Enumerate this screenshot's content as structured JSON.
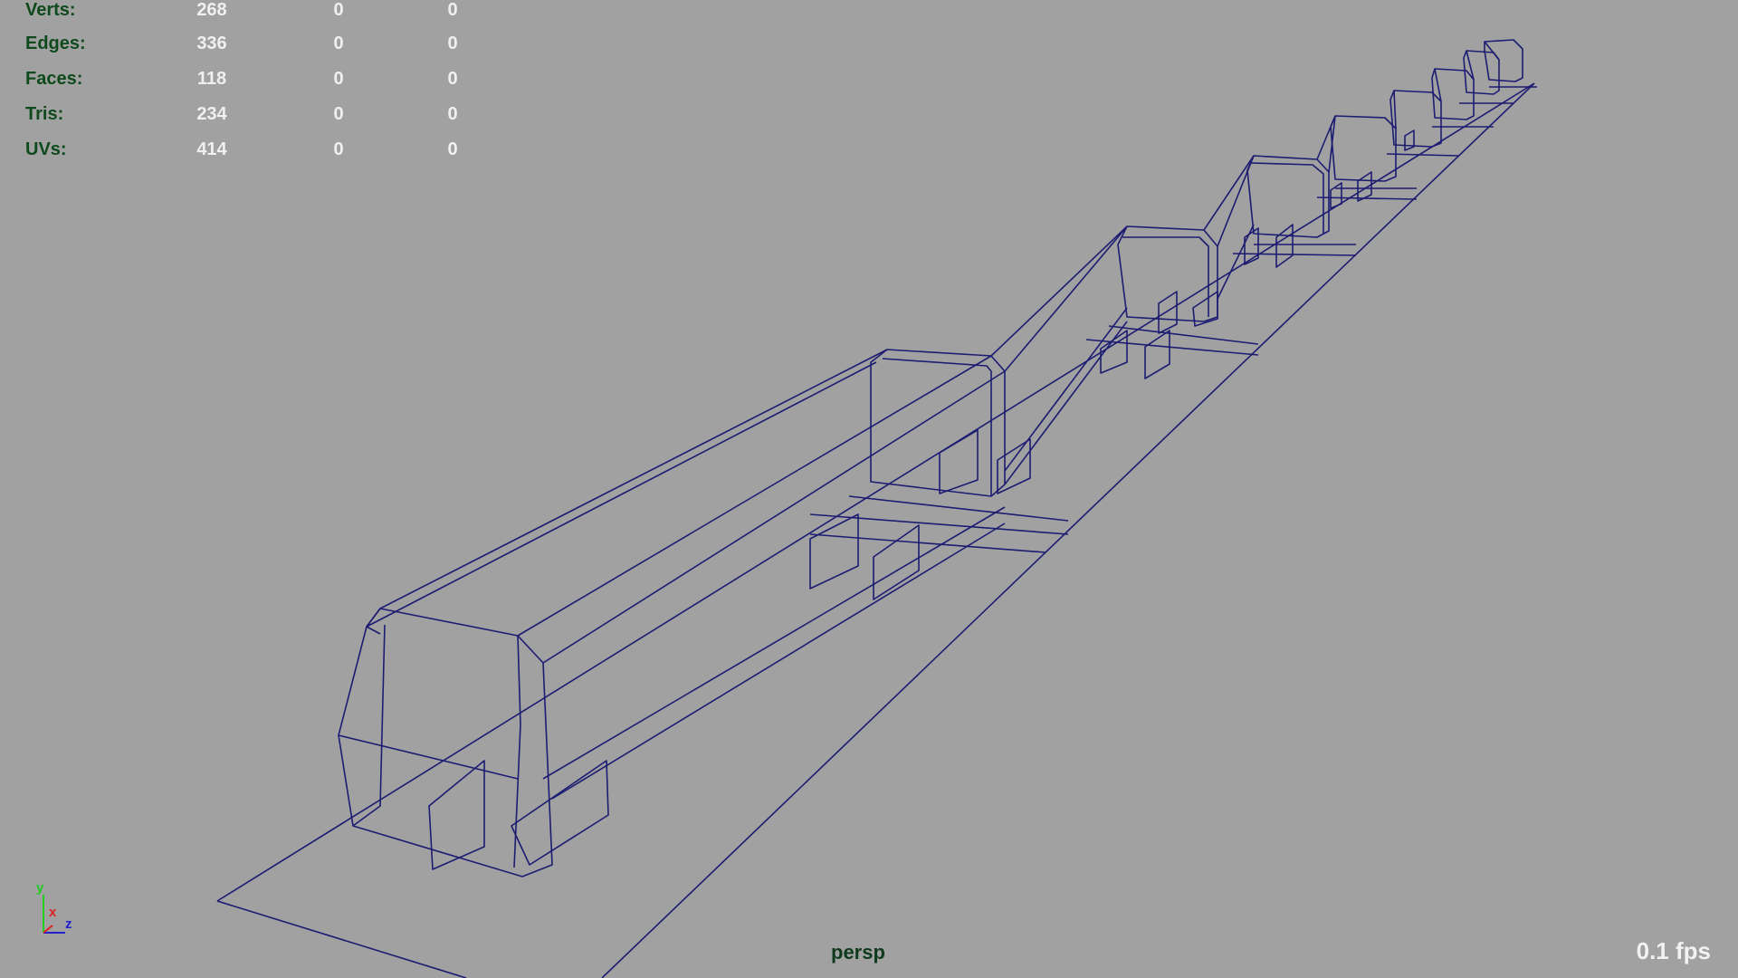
{
  "stats": {
    "rows": [
      {
        "label": "Verts:",
        "values": [
          "268",
          "0",
          "0"
        ]
      },
      {
        "label": "Edges:",
        "values": [
          "336",
          "0",
          "0"
        ]
      },
      {
        "label": "Faces:",
        "values": [
          "118",
          "0",
          "0"
        ]
      },
      {
        "label": "Tris:",
        "values": [
          "234",
          "0",
          "0"
        ]
      },
      {
        "label": "UVs:",
        "values": [
          "414",
          "0",
          "0"
        ]
      }
    ]
  },
  "camera": {
    "name": "persp"
  },
  "fps": {
    "text": "0.1 fps"
  },
  "axis_gizmo": {
    "y": "y",
    "x": "x",
    "z": "z",
    "y_color": "#22cc22",
    "x_color": "#dd2222",
    "z_color": "#2222cc"
  },
  "wire_color": "#1c1c72",
  "background_color": "#a1a1a1"
}
